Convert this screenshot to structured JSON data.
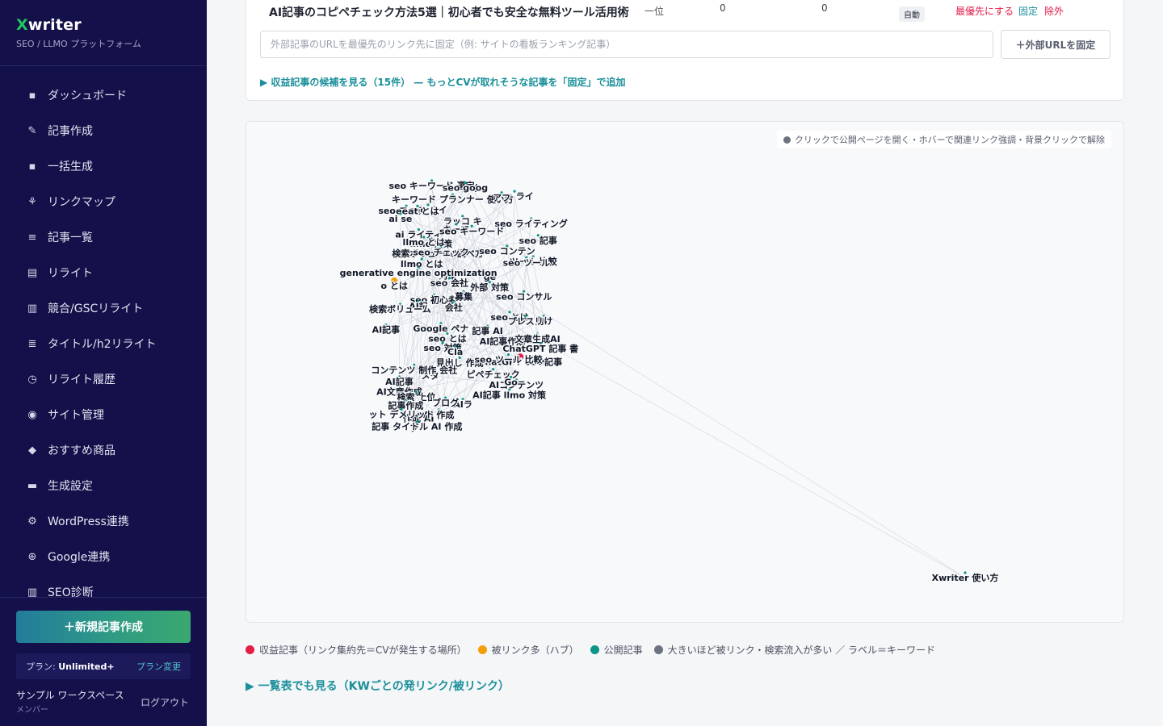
{
  "brand": {
    "title_x": "X",
    "title_rest": "writer",
    "subtitle": "SEO / LLMO プラットフォーム"
  },
  "sidebar": {
    "items": [
      {
        "label": "ダッシュボード",
        "icon": "dashboard-icon",
        "glyph": "▪"
      },
      {
        "label": "記事作成",
        "icon": "pencil-icon",
        "glyph": "✎"
      },
      {
        "label": "一括生成",
        "icon": "grid-icon",
        "glyph": "▪"
      },
      {
        "label": "リンクマップ",
        "icon": "network-icon",
        "glyph": "⚘"
      },
      {
        "label": "記事一覧",
        "icon": "list-icon",
        "glyph": "≡"
      },
      {
        "label": "リライト",
        "icon": "document-icon",
        "glyph": "▤"
      },
      {
        "label": "競合/GSCリライト",
        "icon": "book-icon",
        "glyph": "▥"
      },
      {
        "label": "タイトル/h2リライト",
        "icon": "title-icon",
        "glyph": "≣"
      },
      {
        "label": "リライト履歴",
        "icon": "clock-icon",
        "glyph": "◷"
      },
      {
        "label": "サイト管理",
        "icon": "site-icon",
        "glyph": "◉"
      },
      {
        "label": "おすすめ商品",
        "icon": "tag-icon",
        "glyph": "◆"
      },
      {
        "label": "生成設定",
        "icon": "settings-card-icon",
        "glyph": "▬"
      },
      {
        "label": "WordPress連携",
        "icon": "gear-icon",
        "glyph": "⚙"
      },
      {
        "label": "Google連携",
        "icon": "plus-circle-icon",
        "glyph": "⊕"
      },
      {
        "label": "SEO診断",
        "icon": "chart-icon",
        "glyph": "▥"
      }
    ],
    "new_button": "＋新規記事作成",
    "plan_prefix": "プラン: ",
    "plan_name": "Unlimited+",
    "plan_change": "プラン変更",
    "workspace_name": "サンプル ワークスペース",
    "workspace_role": "メンバー",
    "logout": "ログアウト"
  },
  "pinned_row": {
    "title": "AI記事のコピペチェック方法5選｜初心者でも安全な無料ツール活用術",
    "rank": "一位",
    "inbound": "0",
    "outbound": "0",
    "badge": "自動",
    "action_priority": "最優先にする",
    "action_pin": "固定",
    "action_exclude": "除外"
  },
  "external_url": {
    "placeholder": "外部記事のURLを最優先のリンク先に固定（例: サイトの看板ランキング記事）",
    "button": "＋外部URLを固定"
  },
  "candidates_link": "▶ 収益記事の候補を見る（15件） — もっとCVが取れそうな記事を「固定」で追加",
  "map": {
    "hint": "クリックで公開ページを開く・ホバーで関連リンク強調・背景クリックで解除",
    "colors": {
      "revenue": "#e11d48",
      "hub": "#f59e0b",
      "published": "#0d9488",
      "neutral": "#6b7280",
      "label": "#111827"
    },
    "labels": [
      "オウ",
      "seo キーワード 選定",
      "seo goog",
      "seo ライ",
      "キーワード プランナー 使い方",
      "アフ",
      "seo コンテン",
      "seo ライ",
      "eeat とは",
      "ラッコ キ",
      "ai se",
      "seo ライティング",
      "キーワ",
      "ai ライティ",
      "seo キーワード",
      "llmo 対策",
      "seo 記事",
      "llmo とは",
      "検索ボリューム 調べ方",
      "seo コンテン",
      "seo チェック",
      "ツール 比較",
      "seo ツール",
      "llmo とは",
      "対策",
      "ge",
      "generative engine optimization",
      "o とは",
      "seo 会社",
      "外部 対策",
      "seo 初心者",
      "募集",
      "seo コンサル",
      "会社",
      "AI記",
      "検索ボリューム",
      "seo とは",
      "向け",
      "プレスリ",
      "記事 AI",
      "AI記事",
      "Google ペナ",
      "seo とは",
      "AI記事作成",
      "文章生成AI",
      "seo 対策",
      "Cla",
      "ChatGPT 記事 書",
      "ChatGPT SEO記事",
      "見出し 作成",
      "seo ツール 比較",
      "メタ",
      "コンテンツ 制作 会社",
      "ピペチェック",
      "AIコンテンツ",
      "Go",
      "AI記事",
      "AI文章作成",
      "AI記事 llmo 対策",
      "検索 上位",
      "記事作成",
      "AIラ",
      "ブログ",
      "AI 作成",
      "作成 AI",
      "ット デメリット",
      "ブ",
      "記事 タイトル AI 作成",
      "Xwriter 使い方"
    ],
    "revenue_nodes": [
      "ChatGPT SEO記事"
    ],
    "hub_nodes": [
      "o とは"
    ]
  },
  "legend": [
    {
      "label": "収益記事（リンク集約先＝CVが発生する場所）",
      "color": "#e11d48"
    },
    {
      "label": "被リンク多（ハブ）",
      "color": "#f59e0b"
    },
    {
      "label": "公開記事",
      "color": "#0d9488"
    },
    {
      "label": "大きいほど被リンク・検索流入が多い ／ ラベル＝キーワード",
      "color": "#6b7280"
    }
  ],
  "table_link": "▶ 一覧表でも見る（KWごとの発リンク/被リンク）"
}
